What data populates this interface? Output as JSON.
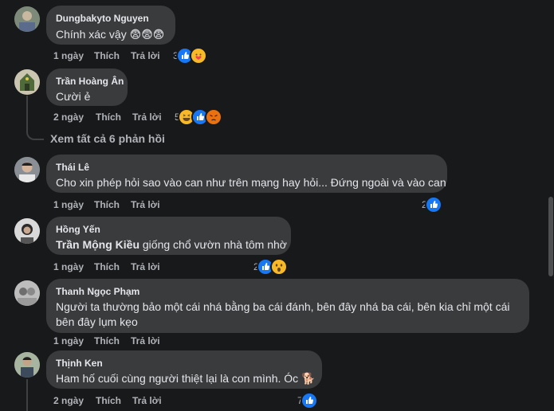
{
  "comments": [
    {
      "author": "Dungbakyto Nguyen",
      "text": "Chính xác vậy 😨😨😨",
      "time": "1 ngày",
      "like": "Thích",
      "reply": "Trả lời",
      "reaction_count": "3",
      "reactions": [
        "like-icon",
        "care-icon"
      ]
    },
    {
      "author": "Trần Hoàng Ân",
      "text": "Cười ẻ",
      "time": "2 ngày",
      "like": "Thích",
      "reply": "Trả lời",
      "reaction_count": "5",
      "reactions": [
        "haha-icon",
        "like-icon",
        "angry-icon"
      ]
    },
    {
      "author": "Thái Lê",
      "text": "Cho xin phép hỏi sao vào can như trên mạng hay hỏi... Đứng ngoài và vào can",
      "time": "1 ngày",
      "like": "Thích",
      "reply": "Trả lời",
      "reaction_count": "2",
      "reactions": [
        "like-icon"
      ]
    },
    {
      "author": "Hồng Yến",
      "mention": "Trần Mộng Kiều",
      "text": " giống chổ vườn nhà tôm nhờ",
      "time": "1 ngày",
      "like": "Thích",
      "reply": "Trả lời",
      "reaction_count": "2",
      "reactions": [
        "like-icon",
        "wow-icon"
      ]
    },
    {
      "author": "Thanh Ngọc Phạm",
      "text": "Người ta thường bảo một cái nhá bằng ba cái đánh, bên đây nhá ba cái, bên kia chỉ một cái bên đây lụm kẹo",
      "time": "1 ngày",
      "like": "Thích",
      "reply": "Trả lời",
      "reaction_count": "",
      "reactions": []
    },
    {
      "author": "Thịnh Ken",
      "text": "Ham hố cuối cùng người thiệt lại là con mình. Óc 🐕",
      "time": "2 ngày",
      "like": "Thích",
      "reply": "Trả lời",
      "reaction_count": "7",
      "reactions": [
        "like-icon"
      ]
    }
  ],
  "view_more": "Xem tất cả 6 phản hồi",
  "colors": {
    "background": "#18191a",
    "bubble": "#3a3b3c",
    "text": "#e4e6eb",
    "secondary": "#b0b3b8",
    "like_blue": "#1877f2"
  }
}
